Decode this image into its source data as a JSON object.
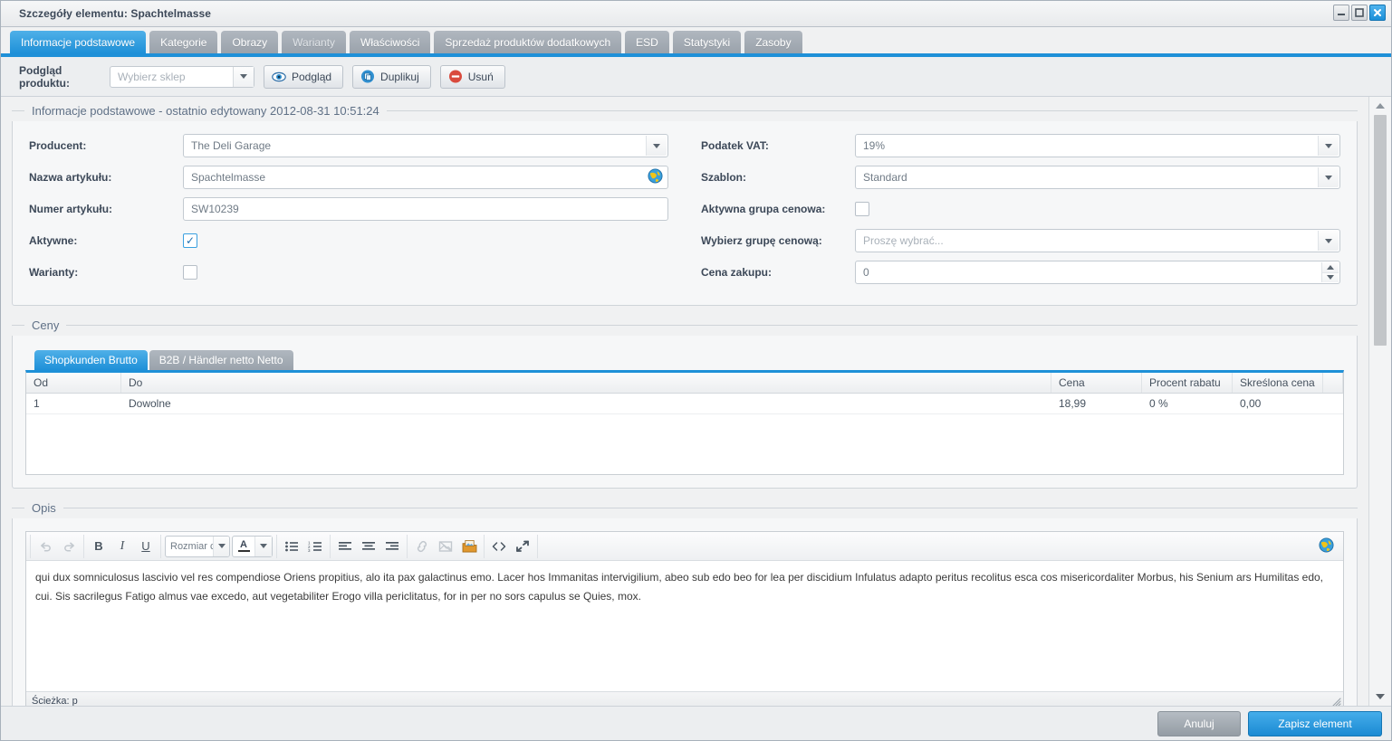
{
  "window": {
    "title": "Szczegóły elementu: Spachtelmasse",
    "controls": {
      "minimize": "minimize-icon",
      "maximize": "maximize-icon",
      "close": "close-icon"
    }
  },
  "tabs": [
    {
      "label": "Informacje podstawowe",
      "active": true,
      "dim": false
    },
    {
      "label": "Kategorie",
      "active": false,
      "dim": false
    },
    {
      "label": "Obrazy",
      "active": false,
      "dim": false
    },
    {
      "label": "Warianty",
      "active": false,
      "dim": true
    },
    {
      "label": "Właściwości",
      "active": false,
      "dim": false
    },
    {
      "label": "Sprzedaż produktów dodatkowych",
      "active": false,
      "dim": false
    },
    {
      "label": "ESD",
      "active": false,
      "dim": false
    },
    {
      "label": "Statystyki",
      "active": false,
      "dim": false
    },
    {
      "label": "Zasoby",
      "active": false,
      "dim": false
    }
  ],
  "preview_bar": {
    "label": "Podgląd produktu:",
    "shop_select_placeholder": "Wybierz sklep",
    "shop_select_value": "",
    "preview_button": "Podgląd",
    "duplicate_button": "Duplikuj",
    "delete_button": "Usuń"
  },
  "basic_info": {
    "legend": "Informacje podstawowe - ostatnio edytowany 2012-08-31 10:51:24",
    "left": {
      "producent_label": "Producent:",
      "producent_value": "The Deli Garage",
      "nazwa_label": "Nazwa artykułu:",
      "nazwa_value": "Spachtelmasse",
      "numer_label": "Numer artykułu:",
      "numer_value": "SW10239",
      "aktywne_label": "Aktywne:",
      "aktywne_checked": true,
      "warianty_label": "Warianty:",
      "warianty_checked": false
    },
    "right": {
      "vat_label": "Podatek VAT:",
      "vat_value": "19%",
      "szablon_label": "Szablon:",
      "szablon_value": "Standard",
      "aktywna_grupa_label": "Aktywna grupa cenowa:",
      "aktywna_grupa_checked": false,
      "wybierz_grupe_label": "Wybierz grupę cenową:",
      "wybierz_grupe_placeholder": "Proszę wybrać...",
      "cena_zakupu_label": "Cena zakupu:",
      "cena_zakupu_value": "0"
    }
  },
  "prices": {
    "legend": "Ceny",
    "tabs": [
      {
        "label": "Shopkunden Brutto",
        "active": true
      },
      {
        "label": "B2B / Händler netto Netto",
        "active": false
      }
    ],
    "columns": [
      "Od",
      "Do",
      "Cena",
      "Procent rabatu",
      "Skreślona cena"
    ],
    "rows": [
      {
        "od": "1",
        "do": "Dowolne",
        "cena": "18,99",
        "rabat": "0 %",
        "skreslona": "0,00"
      }
    ]
  },
  "description": {
    "legend": "Opis",
    "toolbar": {
      "undo": "undo-icon",
      "redo": "redo-icon",
      "bold": "B",
      "italic": "I",
      "underline": "U",
      "fontsize_value": "Rozmiar czc",
      "fontcolor": "A",
      "bullet_list": "bullet-list-icon",
      "numbered_list": "numbered-list-icon",
      "align_left": "align-left-icon",
      "align_center": "align-center-icon",
      "align_right": "align-right-icon",
      "unlink": "unlink-icon",
      "remove_image": "remove-image-icon",
      "insert_media": "insert-media-icon",
      "source_code": "source-code-icon",
      "fullscreen": "fullscreen-icon",
      "language": "globe-icon"
    },
    "body_text": "qui dux somniculosus lascivio vel res compendiose Oriens propitius, alo ita pax galactinus emo. Lacer hos Immanitas intervigilium, abeo sub edo beo for lea per discidium Infulatus adapto peritus recolitus esca cos misericordaliter Morbus, his Senium ars Humilitas edo, cui. Sis sacrilegus Fatigo almus vae excedo, aut vegetabiliter Erogo villa periclitatus, for in per no sors capulus se Quies, mox.",
    "status_path": "Ścieżka: p"
  },
  "footer": {
    "cancel_label": "Anuluj",
    "save_label": "Zapisz element"
  },
  "colors": {
    "accent": "#1e90d8",
    "tab_inactive": "#9aa2ab",
    "delete_red": "#d94a3d",
    "panel_bg": "#f6f7f8"
  }
}
